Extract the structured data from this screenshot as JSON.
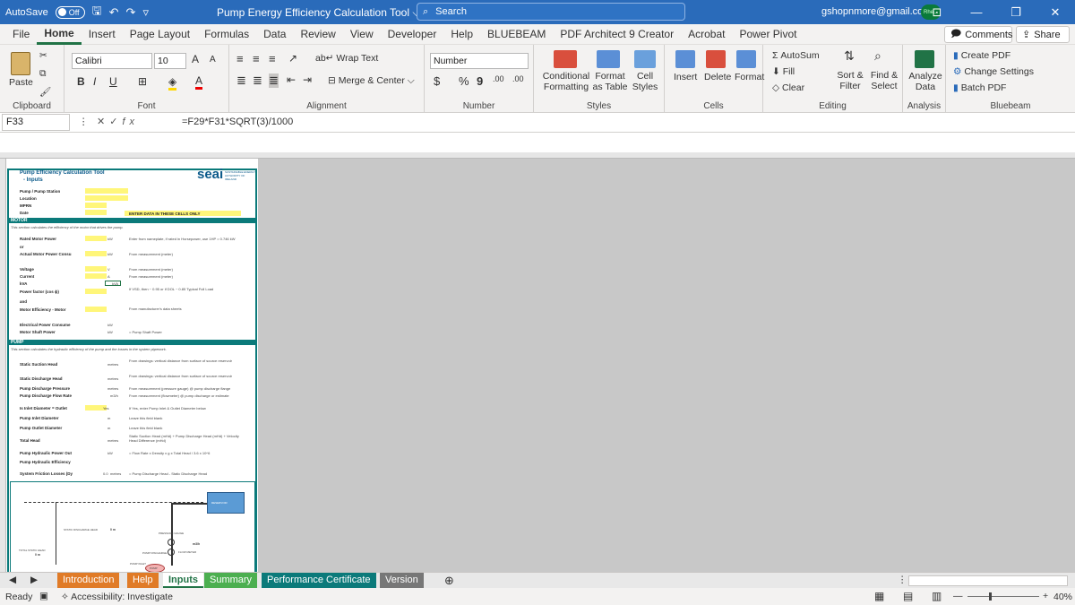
{
  "titlebar": {
    "autosave_label": "AutoSave",
    "autosave_state": "Off",
    "document_title": "Pump Energy Efficiency Calculation Tool",
    "search_placeholder": "Search",
    "user_email": "gshopnmore@gmail.com",
    "avatar_text": "Rhe..."
  },
  "menu": {
    "tabs": [
      "File",
      "Home",
      "Insert",
      "Page Layout",
      "Formulas",
      "Data",
      "Review",
      "View",
      "Developer",
      "Help",
      "BLUEBEAM",
      "PDF Architect 9 Creator",
      "Acrobat",
      "Power Pivot"
    ],
    "active_index": 1,
    "comments_label": "Comments",
    "share_label": "Share"
  },
  "ribbon": {
    "clipboard": {
      "paste": "Paste",
      "label": "Clipboard"
    },
    "font": {
      "name": "Calibri",
      "size": "10",
      "bold": "B",
      "italic": "I",
      "underline": "U",
      "grow": "A",
      "shrink": "A",
      "label": "Font"
    },
    "alignment": {
      "wrap": "Wrap Text",
      "merge": "Merge & Center",
      "label": "Alignment"
    },
    "number": {
      "format": "Number",
      "currency": "$",
      "percent": "%",
      "comma": "9",
      "inc": ".00",
      "dec": ".00",
      "label": "Number"
    },
    "styles": {
      "conditional": "Conditional Formatting",
      "format_table": "Format as Table",
      "cell_styles": "Cell Styles",
      "label": "Styles"
    },
    "cells": {
      "insert": "Insert",
      "delete": "Delete",
      "format": "Format",
      "label": "Cells"
    },
    "editing": {
      "autosum": "AutoSum",
      "fill": "Fill",
      "clear": "Clear",
      "sort": "Sort & Filter",
      "find": "Find & Select",
      "label": "Editing"
    },
    "analysis": {
      "analyze": "Analyze Data",
      "label": "Analysis"
    },
    "bluebeam": {
      "create": "Create PDF",
      "change": "Change Settings",
      "batch": "Batch PDF",
      "label": "Bluebeam"
    }
  },
  "formula_bar": {
    "cell": "F33",
    "fx": "fx",
    "formula": "=F29*F31*SQRT(3)/1000"
  },
  "sheet": {
    "title": "Pump Efficiency Calculation Tool",
    "subtitle": "- Inputs",
    "logo": "seai",
    "logo_tag": "SUSTAINABLE ENERGY AUTHORITY OF IRELAND",
    "fields": [
      "Pump / Pump Station",
      "Location",
      "MPRN",
      "Date"
    ],
    "enter_note": "ENTER DATA IN THESE CELLS ONLY",
    "motor_header": "MOTOR",
    "motor_note": "This section calculates the efficiency of the motor that drives the pump.",
    "rated_power": "Rated Motor Power",
    "or1": "or",
    "actual_power": "Actual Motor Power Consu",
    "voltage": "Voltage",
    "current": "Current",
    "kva": "kVA",
    "power_factor": "Power factor (cos ϕ)",
    "and1": "and",
    "motor_eff": "Motor Efficiency - Motor",
    "elec_power": "Electrical Power Consume",
    "motor_shaft": "Motor Shaft Power",
    "kw": "kW",
    "v": "V",
    "a": "A",
    "kva_unit": "kVA",
    "note_rated": "Enter from nameplate, if rated in Horsepower, use 1HP = 0.746 kW",
    "note_meas": "From measurement (meter)",
    "note_pf": "If VSD, then ~ 0.95 or if DOL ~ 0.85 Typical Full Load",
    "note_mfr": "From manufacturer's data sheets",
    "note_shaft": "= Pump Shaft Power",
    "pump_header": "PUMP",
    "pump_note": "This section calculates the hydraulic efficiency of the pump and the losses in the system pipework.",
    "static_suction": "Static Suction Head",
    "static_discharge": "Static Discharge Head",
    "discharge_pressure": "Pump Discharge Pressure",
    "discharge_flow": "Pump Discharge Flow Rate",
    "inlet_diameter": "Is Inlet Diameter = Outlet",
    "pump_inlet": "Pump Inlet Diameter",
    "pump_outlet": "Pump Outlet Diameter",
    "total_head": "Total Head",
    "hydraulic_power": "Pump Hydraulic Power Out",
    "hydraulic_eff": "Pump Hydraulic Efficiency",
    "friction_loss": "System Friction Losses (Dy",
    "metres": "metres",
    "m": "m",
    "mph": "m3/h",
    "yes": "Yes",
    "note_static": "From drawings: vertical distance from surface of source reservoir",
    "note_pressure": "From measurement (pressure gauge) @ pump discharge flange",
    "note_flow": "From measurement (flowmeter) @ pump discharge or estimate",
    "note_yes": "If Yes, enter Pump Inlet & Outlet Diameter below",
    "note_blank": "Leave this field blank",
    "note_total": "Static Suction Head (mHd) + Pump Discharge Head (mHd) + Velocity Head Difference (mHd)",
    "note_hyd": "= Flow Rate x Density x g x Total Head / 3.6 x 10^6",
    "note_fric": "= Pump Discharge Head - Static Discharge Head",
    "friction_value": "0.0",
    "reservoir": "RESERVOIR",
    "static_label": "STATIC DISCHARGE HEAD",
    "total_static": "TOTAL STATIC HEAD",
    "pressure_gauge": "PRESSURE GAUGE",
    "flow_meter": "FLOW METER",
    "pump_discharge": "PUMP DISCHARGE",
    "pump_inlet_lbl": "PUMP INLET",
    "pump_lbl": "PUMP",
    "zero_m": "0 m"
  },
  "sheet_tabs": [
    "Introduction",
    "Help",
    "Inputs",
    "Summary",
    "Performance Certificate",
    "Version"
  ],
  "active_sheet": "Inputs",
  "status": {
    "ready": "Ready",
    "accessibility": "Accessibility: Investigate",
    "zoom": "40%"
  },
  "colors": {
    "excel_green": "#217346",
    "title_blue": "#2a6bba",
    "teal": "#0b7a7a",
    "orange": "#e07b27",
    "green": "#4caf50",
    "yellow_fill": "#fff67a"
  }
}
